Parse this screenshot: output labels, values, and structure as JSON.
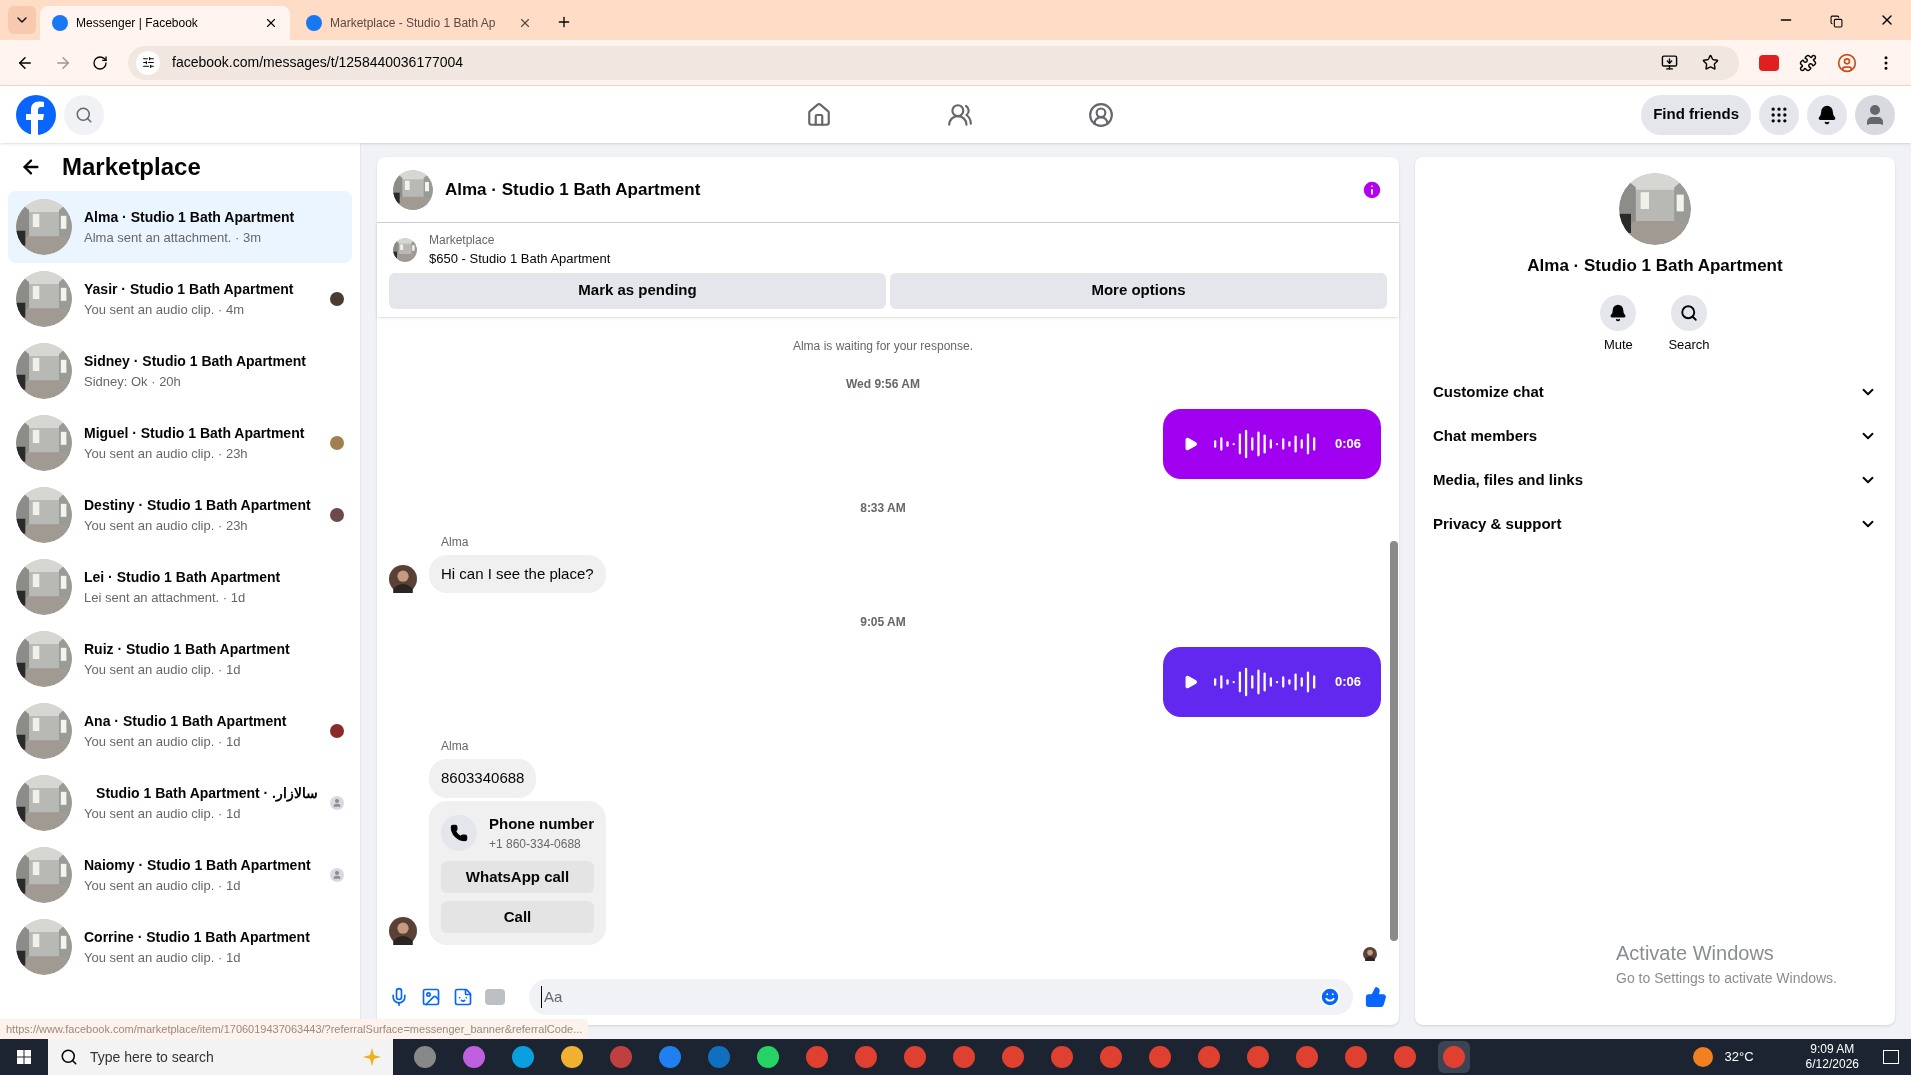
{
  "browser": {
    "tabs": [
      {
        "title": "Messenger | Facebook",
        "selected": true
      },
      {
        "title": "Marketplace - Studio 1 Bath Ap",
        "selected": false
      }
    ],
    "url": "facebook.com/messages/t/1258440036177004"
  },
  "header": {
    "find_friends": "Find friends"
  },
  "sidebar": {
    "title": "Marketplace",
    "conversations": [
      {
        "name": "Alma · Studio 1 Bath Apartment",
        "preview": "Alma sent an attachment. · 3m",
        "selected": true
      },
      {
        "name": "Yasir · Studio 1 Bath Apartment",
        "preview": "You sent an audio clip. · 4m",
        "selected": false,
        "seen": true,
        "color": "#4a3a30"
      },
      {
        "name": "Sidney · Studio 1 Bath Apartment",
        "preview": "Sidney: Ok · 20h",
        "selected": false
      },
      {
        "name": "Miguel · Studio 1 Bath Apartment",
        "preview": "You sent an audio clip. · 23h",
        "selected": false,
        "seen": true,
        "color": "#a08050"
      },
      {
        "name": "Destiny · Studio 1 Bath Apartment",
        "preview": "You sent an audio clip. · 23h",
        "selected": false,
        "seen": true,
        "color": "#6a4a4a"
      },
      {
        "name": "Lei · Studio 1 Bath Apartment",
        "preview": "Lei sent an attachment. · 1d",
        "selected": false
      },
      {
        "name": "Ruiz · Studio 1 Bath Apartment",
        "preview": "You sent an audio clip. · 1d",
        "selected": false
      },
      {
        "name": "Ana · Studio 1 Bath Apartment",
        "preview": "You sent an audio clip. · 1d",
        "selected": false,
        "seen": true,
        "color": "#8a2a2a"
      },
      {
        "name": "سالازار. · Studio 1 Bath Apartment",
        "preview": "You sent an audio clip. · 1d",
        "selected": false,
        "seen": true
      },
      {
        "name": "Naiomy · Studio 1 Bath Apartment",
        "preview": "You sent an audio clip. · 1d",
        "selected": false,
        "seen": true
      },
      {
        "name": "Corrine · Studio 1 Bath Apartment",
        "preview": "You sent an audio clip. · 1d",
        "selected": false
      }
    ]
  },
  "chat": {
    "title": "Alma · Studio 1 Bath Apartment",
    "listing": {
      "label": "Marketplace",
      "title": "$650 - Studio 1 Bath Apartment"
    },
    "actions": [
      "Mark as pending",
      "More options"
    ],
    "messages": [
      {
        "kind": "notice",
        "text": "Alma is waiting for your response."
      },
      {
        "kind": "time",
        "text": "Wed 9:56 AM"
      },
      {
        "kind": "audio",
        "duration": "0:06",
        "color": "#a100f0"
      },
      {
        "kind": "time",
        "text": "8:33 AM"
      },
      {
        "kind": "text",
        "sender": "Alma",
        "text": "Hi can I see the place?"
      },
      {
        "kind": "time",
        "text": "9:05 AM"
      },
      {
        "kind": "audio",
        "duration": "0:06",
        "color": "#6328f0"
      },
      {
        "kind": "contact",
        "sender": "Alma",
        "text": "8603340688",
        "card_title": "Phone number",
        "card_value": "+1 860-334-0688",
        "buttons": [
          "WhatsApp call",
          "Call"
        ]
      }
    ],
    "composer": {
      "placeholder": "Aa"
    }
  },
  "details": {
    "name": "Alma · Studio 1 Bath Apartment",
    "actions": [
      {
        "kind": "mute",
        "label": "Mute"
      },
      {
        "kind": "search",
        "label": "Search"
      }
    ],
    "sections": [
      "Customize chat",
      "Chat members",
      "Media, files and links",
      "Privacy & support"
    ]
  },
  "status_url": "https://www.facebook.com/marketplace/item/1706019437063443/?referralSurface=messenger_banner&referralCode...",
  "activation": {
    "title": "Activate Windows",
    "subtitle": "Go to Settings to activate Windows."
  },
  "taskbar": {
    "search_placeholder": "Type here to search",
    "temperature": "32°C",
    "time": "9:09 AM",
    "date": "6/12/2026"
  }
}
